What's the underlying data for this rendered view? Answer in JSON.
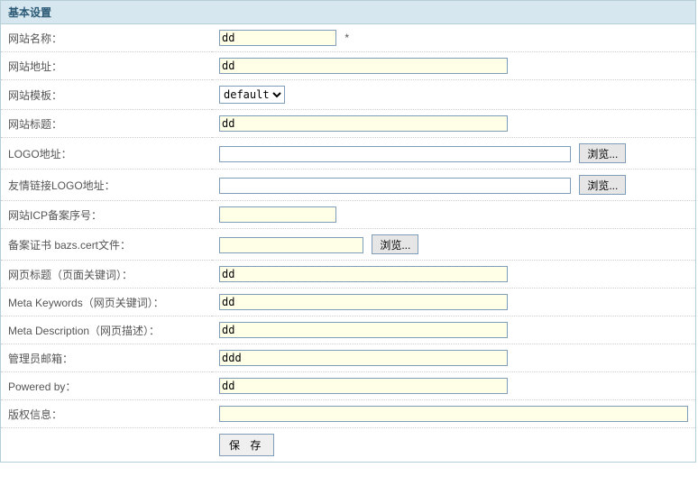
{
  "panel": {
    "title": "基本设置"
  },
  "labels": {
    "site_name": "网站名称：",
    "site_url": "网站地址：",
    "site_template": "网站模板：",
    "site_title": "网站标题：",
    "logo_url": "LOGO地址：",
    "friend_logo_url": "友情链接LOGO地址：",
    "icp": "网站ICP备案序号：",
    "cert_file": "备案证书 bazs.cert文件：",
    "page_title": "网页标题（页面关键词）：",
    "meta_keywords": "Meta Keywords（网页关键词）：",
    "meta_description": "Meta Description（网页描述）：",
    "admin_email": "管理员邮箱：",
    "powered_by": "Powered by：",
    "copyright": "版权信息："
  },
  "values": {
    "site_name": "dd",
    "site_url": "dd",
    "site_template": "default",
    "site_title": "dd",
    "logo_url": "",
    "friend_logo_url": "",
    "icp": "",
    "cert_file": "",
    "page_title": "dd",
    "meta_keywords": "dd",
    "meta_description": "dd",
    "admin_email": "ddd",
    "powered_by": "dd",
    "copyright": ""
  },
  "template_options": [
    "default"
  ],
  "buttons": {
    "browse": "浏览...",
    "save": "保 存"
  },
  "marks": {
    "required": "*"
  }
}
